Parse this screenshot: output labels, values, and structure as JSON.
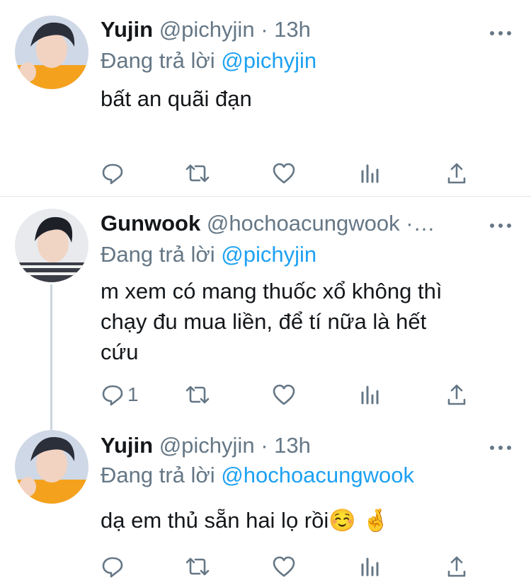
{
  "tweets": [
    {
      "name": "Yujin",
      "handle": "@pichyjin",
      "dot": "·",
      "time": "13h",
      "reply_label": "Đang trả lời",
      "reply_to": "@pichyjin",
      "text": "bất an quãi đạn",
      "reply_count": ""
    },
    {
      "name": "Gunwook",
      "handle": "@hochoacungwook",
      "dot": "·…",
      "time": "",
      "reply_label": "Đang trả lời",
      "reply_to": "@pichyjin",
      "text_lines": [
        "m xem có mang thuốc xổ không thì",
        "chạy đu mua liền, để tí nữa là hết",
        "cứu"
      ],
      "reply_count": "1"
    },
    {
      "name": "Yujin",
      "handle": "@pichyjin",
      "dot": "·",
      "time": "13h",
      "reply_label": "Đang trả lời",
      "reply_to": "@hochoacungwook",
      "text": "dạ em thủ sẵn hai lọ rồi☺️ 🤞",
      "reply_count": ""
    }
  ],
  "icons": [
    "reply-icon",
    "retweet-icon",
    "like-icon",
    "analytics-icon",
    "share-icon",
    "more-icon"
  ],
  "colors": {
    "text": "#14171a",
    "secondary": "#657786",
    "link": "#1da1f2",
    "divider": "#e1e8ed"
  }
}
